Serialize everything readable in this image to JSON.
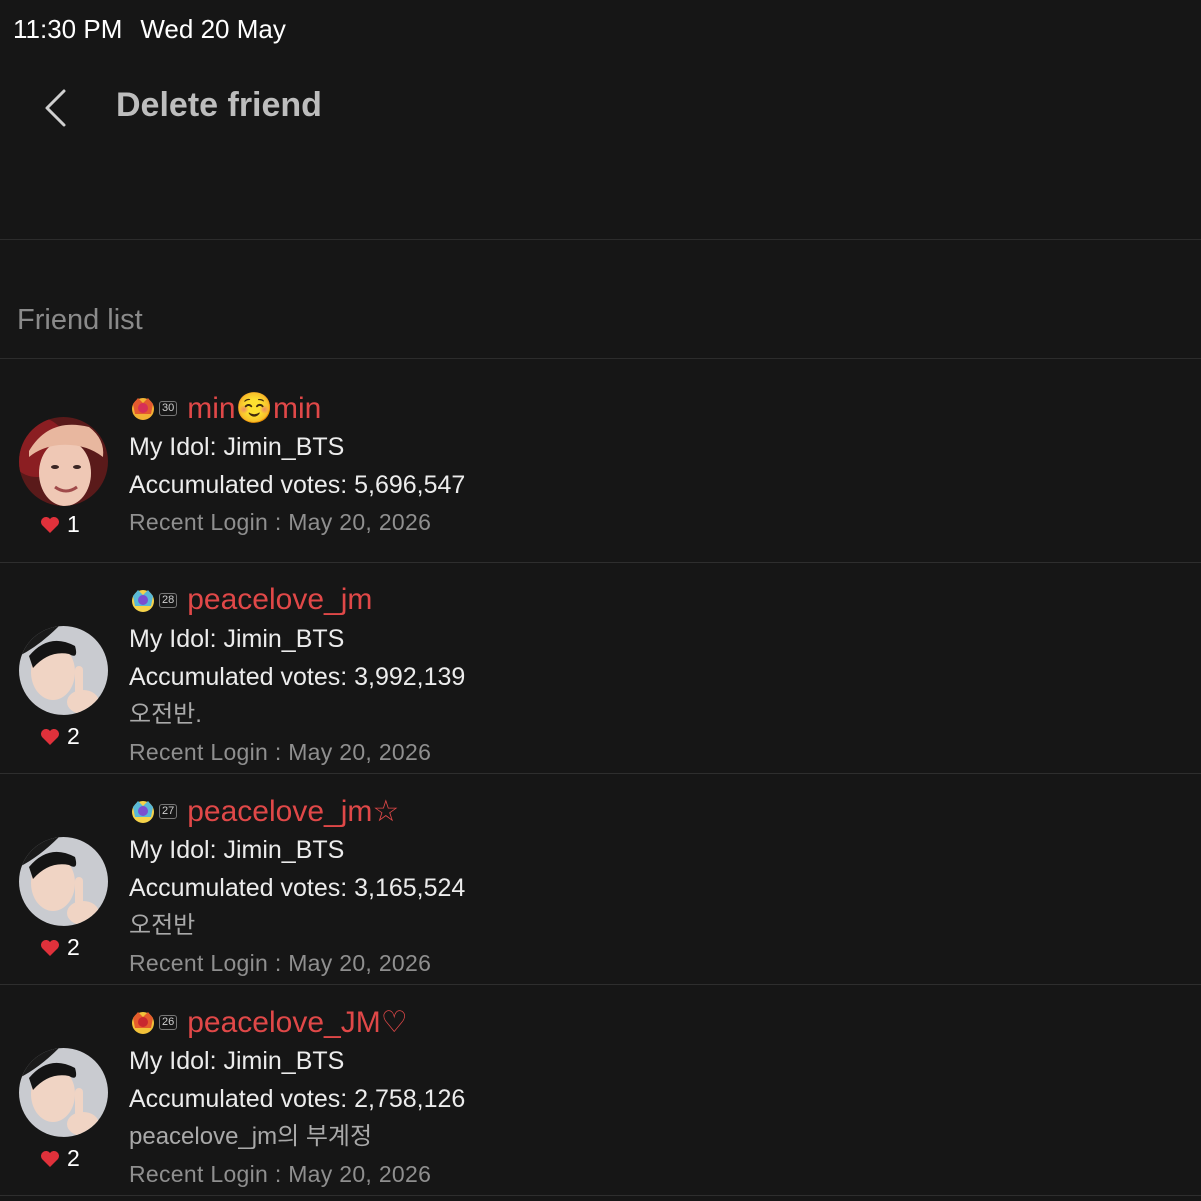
{
  "status_bar": {
    "time": "11:30 PM",
    "date": "Wed 20 May"
  },
  "header": {
    "title": "Delete friend",
    "back_icon": "chevron-left-icon"
  },
  "section": {
    "title": "Friend list"
  },
  "colors": {
    "background": "#161616",
    "name": "#e04848",
    "heart": "#e0313b"
  },
  "friends": [
    {
      "level": "30",
      "name_pre": "min",
      "name_emoji": "☺️",
      "name_post": "min",
      "idol": "My Idol: Jimin_BTS",
      "votes": "Accumulated votes: 5,696,547",
      "memo": "",
      "login": "Recent Login : May 20, 2026",
      "likes": "1"
    },
    {
      "level": "28",
      "name": "peacelove_jm",
      "idol": "My Idol: Jimin_BTS",
      "votes": "Accumulated votes: 3,992,139",
      "memo": "오전반.",
      "login": "Recent Login : May 20, 2026",
      "likes": "2"
    },
    {
      "level": "27",
      "name": "peacelove_jm☆",
      "idol": "My Idol: Jimin_BTS",
      "votes": "Accumulated votes: 3,165,524",
      "memo": "오전반",
      "login": "Recent Login : May 20, 2026",
      "likes": "2"
    },
    {
      "level": "26",
      "name": "peacelove_JM♡",
      "idol": "My Idol: Jimin_BTS",
      "votes": "Accumulated votes: 2,758,126",
      "memo": "peacelove_jm의 부계정",
      "login": "Recent Login : May 20, 2026",
      "likes": "2"
    }
  ]
}
